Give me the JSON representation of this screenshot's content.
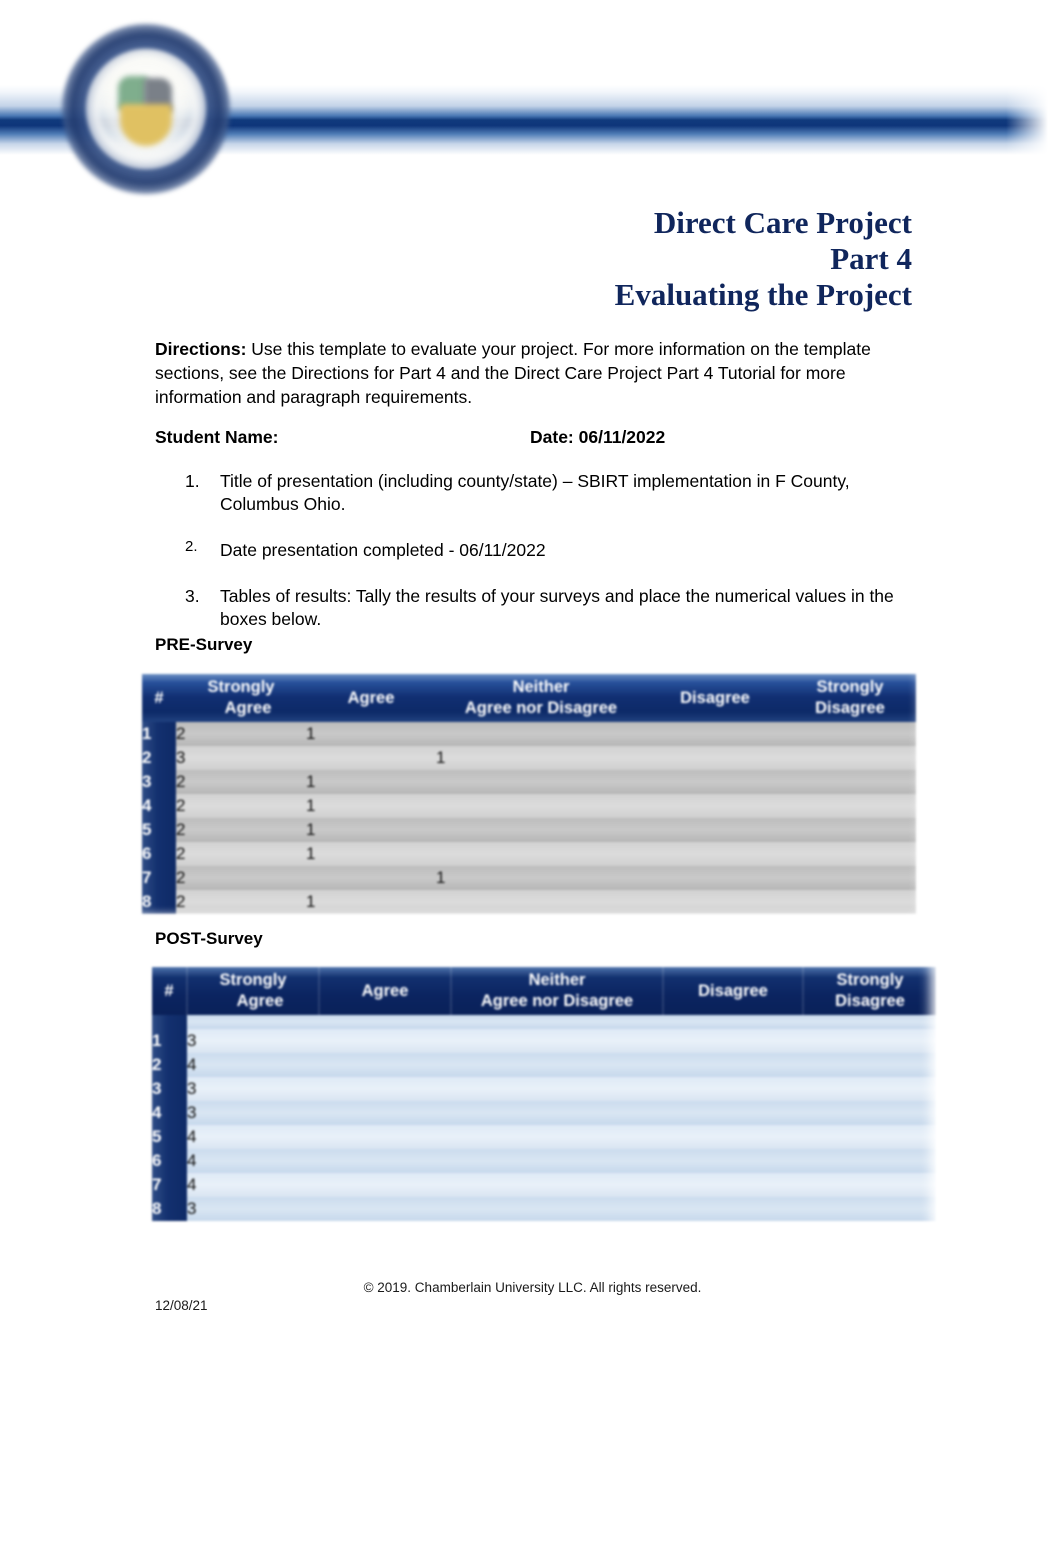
{
  "header": {
    "logo_name": "chamberlain-university-seal",
    "accent_color": "#0e357a"
  },
  "title": {
    "line1": "Direct Care Project",
    "line2": "Part 4",
    "line3": "Evaluating the Project"
  },
  "directions": {
    "label": "Directions:",
    "text": " Use this template to evaluate your project. For more information on the template sections, see the Directions for Part 4 and the Direct Care Project Part 4 Tutorial for more information and paragraph requirements."
  },
  "student_row": {
    "name_label": "Student Name:",
    "name_value": "",
    "date_label": "Date: 06/11/2022"
  },
  "items": [
    {
      "number": "1.",
      "text": "Title of presentation (including county/state) – SBIRT implementation in F County, Columbus Ohio."
    },
    {
      "number": "2.",
      "text": "Date presentation completed  - 06/11/2022"
    },
    {
      "number": "3.",
      "text": "Tables of results: Tally the results of your surveys and place the numerical values in the boxes below."
    }
  ],
  "pre_survey": {
    "label": "PRE-Survey",
    "columns": [
      {
        "id": "hash",
        "l1": "#",
        "l2": ""
      },
      {
        "id": "sa",
        "l1": "Strongly",
        "l2": "Agree"
      },
      {
        "id": "agree",
        "l1": "",
        "l2": "Agree"
      },
      {
        "id": "neither",
        "l1": "Neither",
        "l2": "Agree nor Disagree"
      },
      {
        "id": "dis",
        "l1": "Disagree",
        "l2": ""
      },
      {
        "id": "sd",
        "l1": "Strongly",
        "l2": "Disagree"
      }
    ],
    "rows": [
      {
        "n": "1",
        "sa": "2",
        "agree": "1",
        "neither": "",
        "dis": "",
        "sd": ""
      },
      {
        "n": "2",
        "sa": "3",
        "agree": "",
        "neither": "1",
        "dis": "",
        "sd": ""
      },
      {
        "n": "3",
        "sa": "2",
        "agree": "1",
        "neither": "",
        "dis": "",
        "sd": ""
      },
      {
        "n": "4",
        "sa": "2",
        "agree": "1",
        "neither": "",
        "dis": "",
        "sd": ""
      },
      {
        "n": "5",
        "sa": "2",
        "agree": "1",
        "neither": "",
        "dis": "",
        "sd": ""
      },
      {
        "n": "6",
        "sa": "2",
        "agree": "1",
        "neither": "",
        "dis": "",
        "sd": ""
      },
      {
        "n": "7",
        "sa": "2",
        "agree": "",
        "neither": "1",
        "dis": "",
        "sd": ""
      },
      {
        "n": "8",
        "sa": "2",
        "agree": "1",
        "neither": "",
        "dis": "",
        "sd": ""
      }
    ]
  },
  "post_survey": {
    "label": "POST-Survey",
    "columns": [
      {
        "id": "hash",
        "l1": "#",
        "l2": ""
      },
      {
        "id": "sa",
        "l1": "Strongly",
        "l2": "Agree"
      },
      {
        "id": "agree",
        "l1": "",
        "l2": "Agree"
      },
      {
        "id": "neither",
        "l1": "Neither",
        "l2": "Agree nor Disagree"
      },
      {
        "id": "dis",
        "l1": "Disagree",
        "l2": ""
      },
      {
        "id": "sd",
        "l1": "Strongly",
        "l2": "Disagree"
      }
    ],
    "rows": [
      {
        "n": "1",
        "sa": "3",
        "agree": "",
        "neither": "",
        "dis": "",
        "sd": ""
      },
      {
        "n": "2",
        "sa": "4",
        "agree": "",
        "neither": "",
        "dis": "",
        "sd": ""
      },
      {
        "n": "3",
        "sa": "3",
        "agree": "",
        "neither": "",
        "dis": "",
        "sd": ""
      },
      {
        "n": "4",
        "sa": "3",
        "agree": "",
        "neither": "",
        "dis": "",
        "sd": ""
      },
      {
        "n": "5",
        "sa": "4",
        "agree": "",
        "neither": "",
        "dis": "",
        "sd": ""
      },
      {
        "n": "6",
        "sa": "4",
        "agree": "",
        "neither": "",
        "dis": "",
        "sd": ""
      },
      {
        "n": "7",
        "sa": "4",
        "agree": "",
        "neither": "",
        "dis": "",
        "sd": ""
      },
      {
        "n": "8",
        "sa": "3",
        "agree": "",
        "neither": "",
        "dis": "",
        "sd": ""
      }
    ]
  },
  "footer": {
    "copyright": "© 2019. Chamberlain University LLC. All rights reserved.",
    "date": "12/08/21"
  }
}
